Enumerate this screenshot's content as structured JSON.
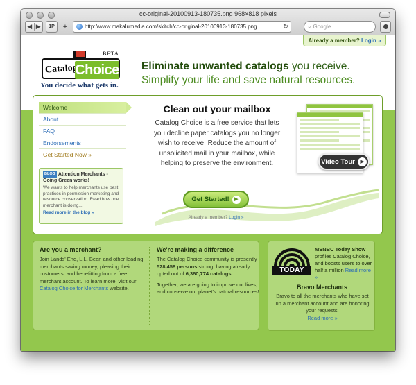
{
  "window": {
    "title": "cc-original-20100913-180735.png 968×818 pixels"
  },
  "toolbar": {
    "back": "◀",
    "forward": "▶",
    "onepassword": "1P",
    "add": "+",
    "url": "http://www.makalumedia.com/skitch/cc-original-20100913-180735.png",
    "reload": "↻",
    "search_placeholder": "Google"
  },
  "site": {
    "member_prompt": "Already a member?",
    "login": "Login »",
    "logo": {
      "catalog": "Catalog",
      "choice": "Choice",
      "beta": "BETA",
      "tagline": "You decide what gets in."
    },
    "headline": {
      "strong": "Eliminate unwanted catalogs",
      "rest": " you receive.",
      "line2": "Simplify your life and save natural resources."
    },
    "nav": [
      "Welcome",
      "About",
      "FAQ",
      "Endorsements",
      "Get Started Now »"
    ],
    "blog": {
      "tag": "BLOG",
      "title": "Attention Merchants - Going Green works!",
      "body": "We wants to help merchants use best practices in permission marketing and resource conservation. Read how one merchant is doing...",
      "more": "Read more in the blog »"
    },
    "main": {
      "title": "Clean out your mailbox",
      "body": "Catalog Choice is a free service that lets you decline paper catalogs you no longer wish to receive. Reduce the amount of unsolicited mail in your mailbox, while helping to preserve the environment.",
      "cta": "Get Started!",
      "already": "Already a member?",
      "login": "Login »",
      "video": "Video Tour"
    },
    "merchant": {
      "title": "Are you a merchant?",
      "body": "Join Lands' End, L.L. Bean and other leading merchants saving money, pleasing their customers, and benefitting from a free merchant account. To learn more, visit our",
      "link": "Catalog Choice for Merchants",
      "tail": " website."
    },
    "difference": {
      "title": "We're making a difference",
      "p1_a": "The Catalog Choice community is presently ",
      "persons": "528,458 persons",
      "p1_b": " strong, having already opted out of ",
      "catalogs": "6,360,774 catalogs",
      "p1_c": ".",
      "p2": "Together, we are going to improve our lives, and conserve our planet's natural resources!"
    },
    "press": {
      "logo_word": "TODAY",
      "title": "MSNBC Today Show",
      "body": "profiles Catalog Choice, and boosts users to over half a million",
      "more": "Read more »",
      "bravo_title": "Bravo Merchants",
      "bravo_body": "Bravo to all the merchants who have set up a merchant account and are honoring your requests.",
      "bravo_more": "Read more »"
    }
  }
}
